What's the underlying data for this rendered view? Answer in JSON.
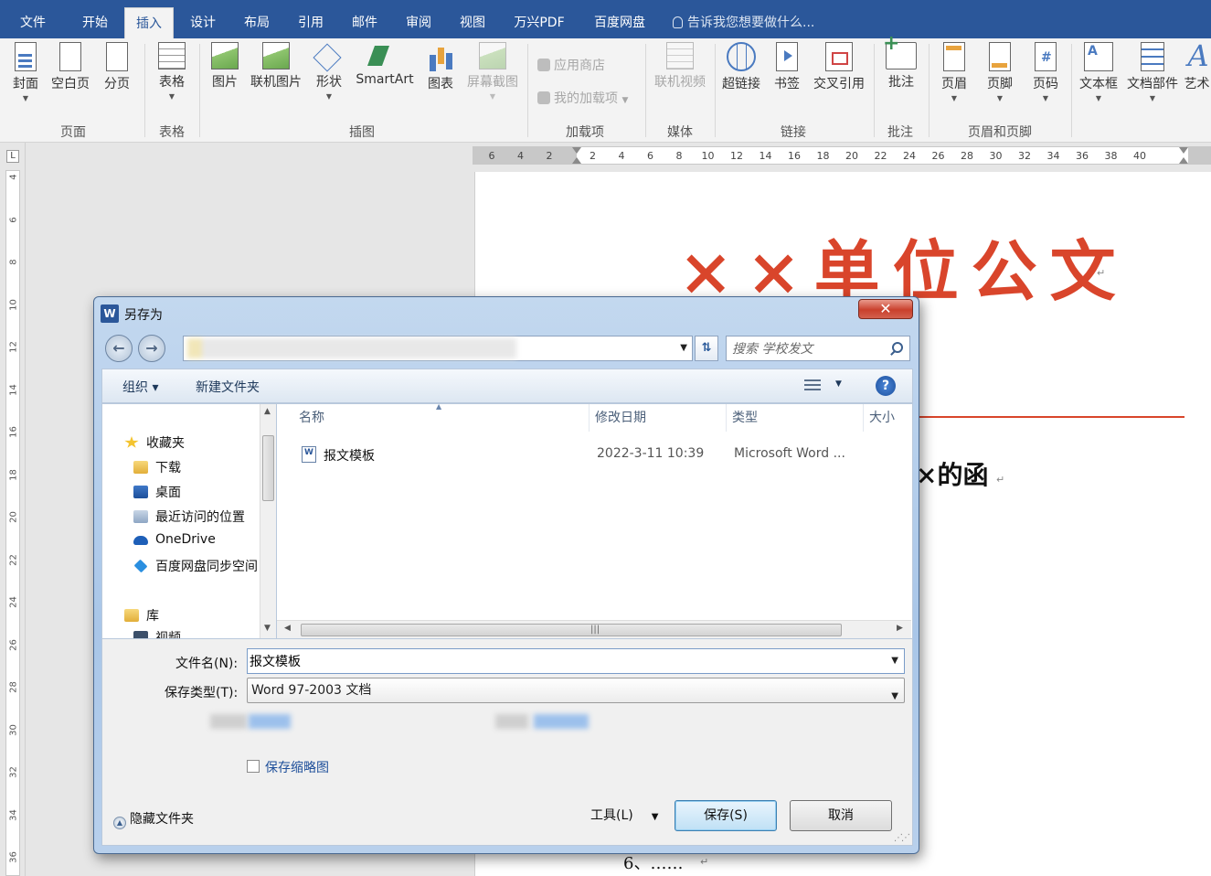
{
  "ribbon": {
    "tabs": [
      "文件",
      "开始",
      "插入",
      "设计",
      "布局",
      "引用",
      "邮件",
      "审阅",
      "视图",
      "万兴PDF",
      "百度网盘"
    ],
    "active_tab": "插入",
    "tell_me": "告诉我您想要做什么...",
    "buttons": {
      "cover": "封面",
      "blank": "空白页",
      "break": "分页",
      "table": "表格",
      "picture": "图片",
      "online_picture": "联机图片",
      "shapes": "形状",
      "smartart": "SmartArt",
      "chart": "图表",
      "screenshot": "屏幕截图",
      "store": "应用商店",
      "my_addins": "我的加载项",
      "online_video": "联机视频",
      "hyperlink": "超链接",
      "bookmark": "书签",
      "cross_ref": "交叉引用",
      "comment": "批注",
      "header": "页眉",
      "footer": "页脚",
      "page_number": "页码",
      "textbox": "文本框",
      "doc_parts": "文档部件",
      "wordart": "艺术"
    },
    "groups": {
      "pages": "页面",
      "tables": "表格",
      "illustrations": "插图",
      "addins": "加载项",
      "media": "媒体",
      "links": "链接",
      "comments": "批注",
      "header_footer": "页眉和页脚"
    }
  },
  "ruler": {
    "h_ticks": [
      "6",
      "4",
      "2",
      "2",
      "4",
      "6",
      "8",
      "10",
      "12",
      "14",
      "16",
      "18",
      "20",
      "22",
      "24",
      "26",
      "28",
      "30",
      "32",
      "34",
      "36",
      "38",
      "40"
    ],
    "v_ticks": [
      "4",
      "6",
      "8",
      "10",
      "12",
      "14",
      "16",
      "18",
      "20",
      "22",
      "24",
      "26",
      "28",
      "30",
      "32",
      "34",
      "36"
    ],
    "corner": "L"
  },
  "document": {
    "title": "××单位公文",
    "subtitle_fragment": "×的函",
    "list_item": "6、……",
    "para_mark": "↵"
  },
  "dialog": {
    "title": "另存为",
    "app_icon": "W",
    "close": "✕",
    "search_placeholder": "搜索 学校发文",
    "toolbar": {
      "organize": "组织 ▾",
      "new_folder": "新建文件夹",
      "help": "?"
    },
    "nav": {
      "favorites": "收藏夹",
      "downloads": "下载",
      "desktop": "桌面",
      "recent": "最近访问的位置",
      "onedrive": "OneDrive",
      "baidu": "百度网盘同步空间",
      "libraries": "库",
      "videos": "视频"
    },
    "columns": {
      "name": "名称",
      "modified": "修改日期",
      "type": "类型",
      "size": "大小"
    },
    "files": [
      {
        "name": "报文模板",
        "modified": "2022-3-11 10:39",
        "type": "Microsoft Word ..."
      }
    ],
    "filename_label": "文件名(N):",
    "filename_value": "报文模板",
    "filetype_label": "保存类型(T):",
    "filetype_value": "Word 97-2003 文档",
    "save_thumbnail": "保存缩略图",
    "hide_folders": "隐藏文件夹",
    "tools": "工具(L)",
    "save": "保存(S)",
    "cancel": "取消"
  },
  "colors": {
    "ribbon_blue": "#2b579a",
    "doc_red": "#d9452b"
  }
}
